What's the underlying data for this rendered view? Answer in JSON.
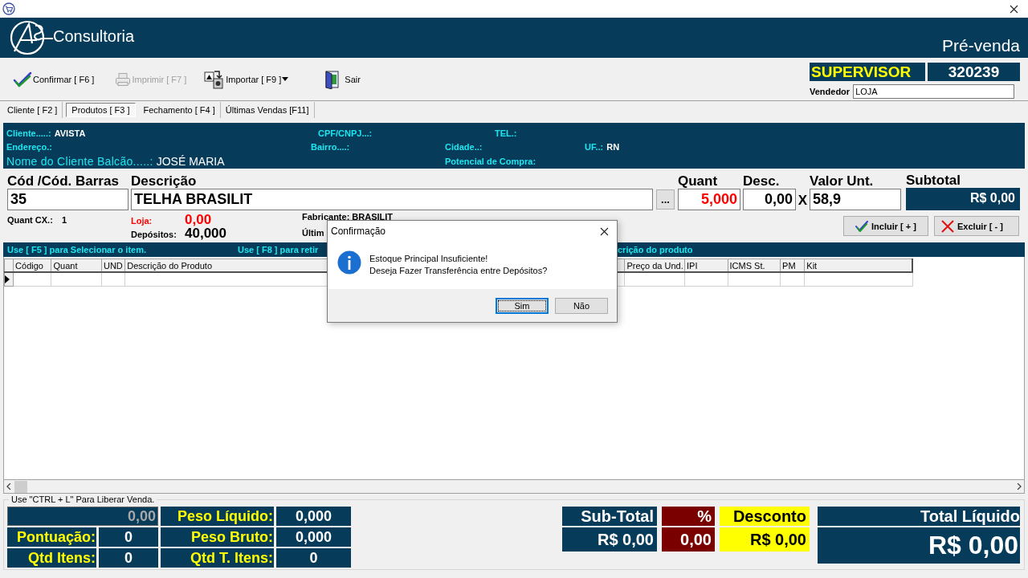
{
  "header": {
    "brand": "Consultoria",
    "screen_title": "Pré-venda"
  },
  "toolbar": {
    "buttons": [
      {
        "label": "Confirmar [ F6 ]",
        "kind": "confirm",
        "disabled": false,
        "dropdown": false
      },
      {
        "label": "Imprimir  [ F7 ]",
        "kind": "print",
        "disabled": true,
        "dropdown": false
      },
      {
        "label": "Importar [ F9 ]",
        "kind": "import",
        "disabled": false,
        "dropdown": true
      },
      {
        "label": "Sair",
        "kind": "exit",
        "disabled": false,
        "dropdown": false
      }
    ]
  },
  "user": {
    "role": "SUPERVISOR",
    "code": "320239",
    "seller_label": "Vendedor",
    "seller": "LOJA"
  },
  "tabs": [
    {
      "label": "Cliente [ F2 ]",
      "selected": false
    },
    {
      "label": "Produtos [ F3 ]",
      "selected": true
    },
    {
      "label": "Fechamento [ F4 ]",
      "selected": false
    },
    {
      "label": "Últimas Vendas [F11]",
      "selected": false
    }
  ],
  "client": {
    "fields": [
      {
        "label": "Cliente.....:",
        "value": "AVISTA"
      },
      {
        "label": "CPF/CNPJ...:"
      },
      {
        "label": "TEL.:"
      },
      {
        "label": "Endereço.:"
      },
      {
        "label": "Bairro....:"
      },
      {
        "label": "Cidade..:"
      },
      {
        "label": "UF..:",
        "value": "RN"
      },
      {
        "label": "Nome do Cliente Balcão.....:",
        "value": "JOSÉ MARIA"
      },
      {
        "label": "Potencial de Compra:"
      }
    ]
  },
  "product": {
    "code_label": "Cód /Cód. Barras",
    "code": "35",
    "description_label": "Descrição",
    "description": "TELHA BRASILIT",
    "lookup_button": "...",
    "quantity_label": "Quant",
    "quantity": "5,000",
    "discount_label": "Desc.",
    "discount": "0,00",
    "times": "X",
    "unit_price_label": "Valor Unt.",
    "unit_price": "58,9",
    "subtotal_label": "Subtotal",
    "subtotal": "R$ 0,00",
    "box_qty_label": "Quant CX.:",
    "box_qty": "1",
    "store_label": "Loja:",
    "store_stock": "0,00",
    "warehouse_label": "Depósitos:",
    "warehouse_stock": "40,000",
    "manufacturer": "Fabricante: BRASILIT",
    "last": "Últim",
    "include_button": "Incluir [ + ]",
    "remove_button": "Excluir [ - ]"
  },
  "hints": [
    "Use [ F5 ] para Selecionar o item.",
    "Use [ F8 ] para retir",
    "crição do produto"
  ],
  "table": {
    "columns": [
      "Código",
      "Quant",
      "UND",
      "Descrição do Produto",
      "Preço da Und.",
      "IPI",
      "ICMS St.",
      "PM",
      "Kit"
    ],
    "rows": [
      {
        "current": true
      }
    ]
  },
  "footer": {
    "legend": "Use \"CTRL + L\" Para Liberar Venda.",
    "total_value": "0,00",
    "stats": [
      {
        "label": "Peso Líquido:",
        "value": "0,000"
      },
      {
        "label": "Pontuação:",
        "value": "0"
      },
      {
        "label": "Peso Bruto:",
        "value": "0,000"
      },
      {
        "label": "Qtd Itens:",
        "value": "0"
      },
      {
        "label": "Qtd T. Itens:",
        "value": "0"
      }
    ],
    "totals": [
      {
        "label": "Sub-Total",
        "value": "R$ 0,00",
        "kind": "subtotal"
      },
      {
        "label": "%",
        "value": "0,00",
        "kind": "percent"
      },
      {
        "label": "Desconto",
        "value": "R$ 0,00",
        "kind": "discount"
      }
    ],
    "net_label": "Total Líquido",
    "net_value": "R$ 0,00"
  },
  "dialog": {
    "title": "Confirmação",
    "lines": [
      "Estoque Principal Insuficiente!",
      "Deseja Fazer Transferência entre Depósitos?"
    ],
    "buttons": [
      {
        "label": "Sim",
        "focused": true
      },
      {
        "label": "Não",
        "focused": false
      }
    ]
  }
}
